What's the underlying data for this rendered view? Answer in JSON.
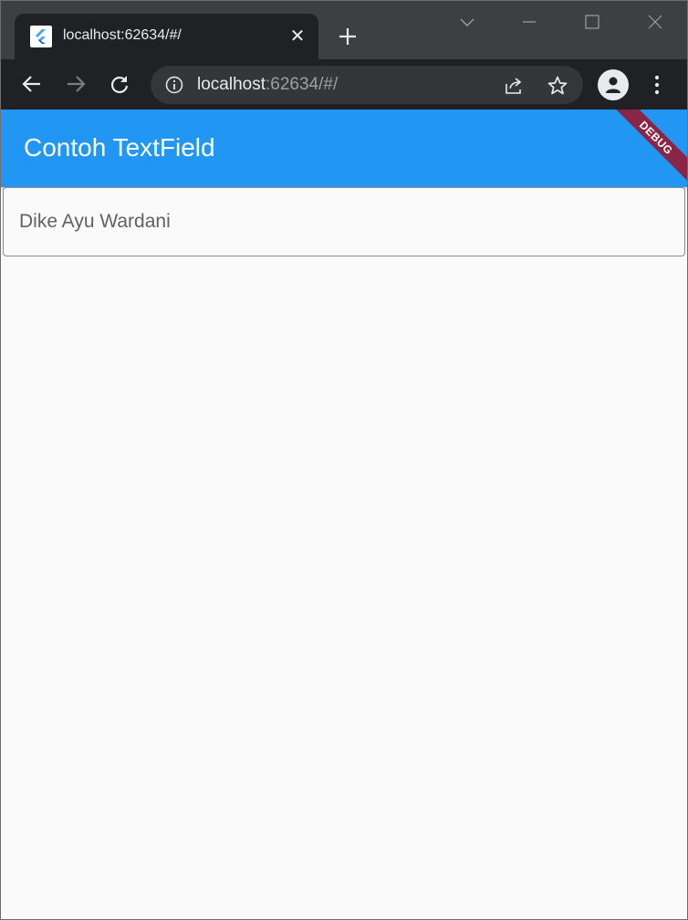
{
  "browser": {
    "tab": {
      "title": "localhost:62634/#/",
      "favicon": "flutter-icon",
      "close": "✕"
    },
    "new_tab": "plus-icon",
    "address": {
      "host": "localhost",
      "rest": ":62634/#/"
    },
    "colors": {
      "tabstrip": "#3c4043",
      "toolbar": "#202124",
      "omnibox": "#35363a"
    }
  },
  "app": {
    "title": "Contoh TextField",
    "debug_banner": "DEBUG",
    "colors": {
      "app_bar": "#2196f3",
      "debug_banner": "#8b2545",
      "background": "#fafafa"
    },
    "text_field": {
      "value": "Dike Ayu Wardani"
    }
  }
}
